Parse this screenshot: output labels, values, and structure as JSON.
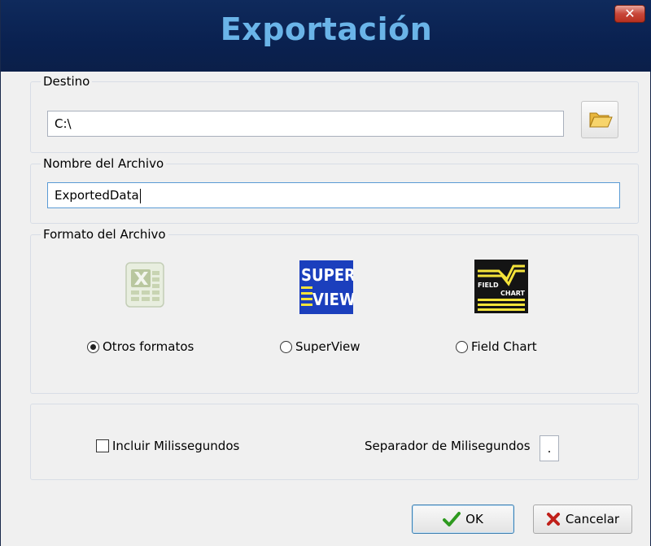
{
  "window": {
    "title": "Exportación",
    "close_label": "✕"
  },
  "destino": {
    "label": "Destino",
    "path_value": "C:\\",
    "browse_icon": "folder-open-icon"
  },
  "nombre": {
    "label": "Nombre del Archivo",
    "value": "ExportedData"
  },
  "formato": {
    "label": "Formato del Archivo",
    "selected": "Otros formatos",
    "options": [
      {
        "label": "Otros formatos",
        "icon": "excel-icon",
        "checked": true
      },
      {
        "label": "SuperView",
        "icon": "superview-icon",
        "checked": false,
        "logo_text_top": "SUPER",
        "logo_text_bottom": "VIEW"
      },
      {
        "label": "Field Chart",
        "icon": "field-chart-icon",
        "checked": false,
        "logo_text_top": "FIELD",
        "logo_text_bottom": "CHART"
      }
    ]
  },
  "opciones": {
    "include_ms_label": "Incluir Milissegundos",
    "include_ms_checked": false,
    "separator_label": "Separador de Milisegundos",
    "separator_value": "."
  },
  "buttons": {
    "ok_label": "OK",
    "cancel_label": "Cancelar"
  },
  "colors": {
    "title_bar": "#0a2150",
    "title_text": "#6ab4e8",
    "ok_check": "#2e9a1f",
    "cancel_x": "#c0201a"
  }
}
